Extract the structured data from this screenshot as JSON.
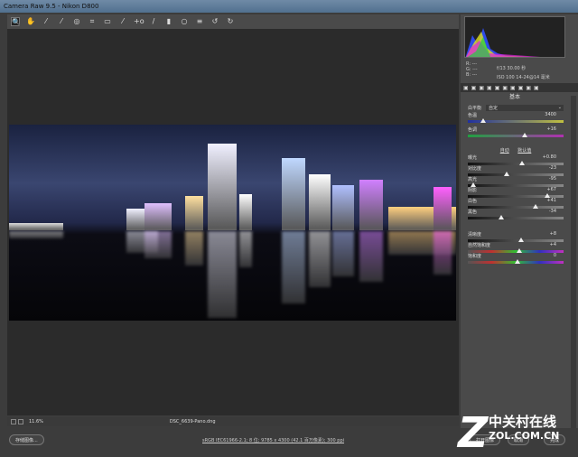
{
  "window": {
    "title": "Camera Raw 9.5 - Nikon D800"
  },
  "toolbar": {
    "tools": [
      "zoom-icon",
      "hand-icon",
      "white-balance-icon",
      "color-sampler-icon",
      "target-adjust-icon",
      "crop-icon",
      "straighten-icon",
      "spot-removal-icon",
      "red-eye-icon",
      "brush-icon",
      "graduated-filter-icon",
      "radial-filter-icon",
      "presets-icon",
      "rotate-left-icon",
      "rotate-right-icon"
    ]
  },
  "status": {
    "zoom": "11.6%",
    "filename": "DSC_6639-Pano.dng"
  },
  "info": {
    "r": "R: ---",
    "g": "G: ---",
    "b": "B: ---",
    "aperture_shutter": "f/13   30.00 秒",
    "iso_lens": "ISO 100   14-24@14 毫米"
  },
  "panel": {
    "title": "基本",
    "wb_label": "白平衡",
    "wb_value": "自定",
    "auto": "自动",
    "default": "默认值",
    "sliders": [
      {
        "label": "色温",
        "value": "3400",
        "pos": 0.14,
        "track": "temp"
      },
      {
        "label": "色调",
        "value": "+16",
        "pos": 0.58,
        "track": "tint"
      },
      {
        "label": "曝光",
        "value": "+0.80",
        "pos": 0.55,
        "track": "gray"
      },
      {
        "label": "对比度",
        "value": "-23",
        "pos": 0.39,
        "track": "gray"
      },
      {
        "label": "高光",
        "value": "-95",
        "pos": 0.03,
        "track": "gray"
      },
      {
        "label": "阴影",
        "value": "+67",
        "pos": 0.83,
        "track": "gray"
      },
      {
        "label": "白色",
        "value": "+41",
        "pos": 0.7,
        "track": "gray"
      },
      {
        "label": "黑色",
        "value": "-34",
        "pos": 0.33,
        "track": "gray"
      },
      {
        "label": "清晰度",
        "value": "+8",
        "pos": 0.54,
        "track": "gray"
      },
      {
        "label": "自然饱和度",
        "value": "+4",
        "pos": 0.52,
        "track": "sat"
      },
      {
        "label": "饱和度",
        "value": "0",
        "pos": 0.5,
        "track": "sat"
      }
    ]
  },
  "bottom": {
    "save": "存储图像...",
    "workflow": "sRGB IEC61966-2.1; 8 位; 9785 x 4300 (42.1 百万像素); 300 ppi",
    "open": "打开图像",
    "cancel": "取消",
    "done": "完成"
  },
  "watermark": {
    "cn": "中关村在线",
    "en": "ZOL.COM.CN"
  }
}
